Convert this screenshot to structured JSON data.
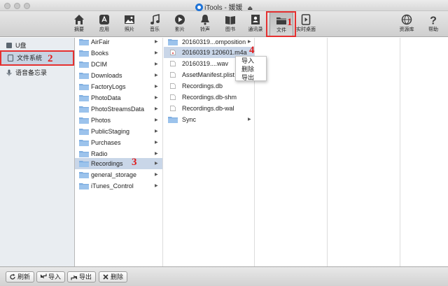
{
  "window": {
    "app_name": "iTools",
    "separator": "-",
    "device_name": "媛媛",
    "eject_glyph": "⏏"
  },
  "toolbar": {
    "items": [
      {
        "label": "摘要",
        "icon": "home-icon"
      },
      {
        "label": "应用",
        "icon": "apps-icon"
      },
      {
        "label": "照片",
        "icon": "photos-icon"
      },
      {
        "label": "音乐",
        "icon": "music-icon"
      },
      {
        "label": "影片",
        "icon": "play-icon"
      },
      {
        "label": "铃声",
        "icon": "bell-icon"
      },
      {
        "label": "图书",
        "icon": "books-icon"
      },
      {
        "label": "通讯录",
        "icon": "contacts-icon"
      },
      {
        "label": "文件",
        "icon": "folder-icon",
        "active": true
      },
      {
        "label": "实时桌面",
        "icon": "live-desktop-icon"
      },
      {
        "label": "资源库",
        "icon": "resource-icon"
      },
      {
        "label": "帮助",
        "icon": "help-icon"
      }
    ]
  },
  "sidebar": {
    "items": [
      {
        "label": "U盘",
        "icon": "usb-drive-icon"
      },
      {
        "label": "文件系统",
        "icon": "file-system-icon",
        "selected": true
      },
      {
        "label": "语音备忘录",
        "icon": "microphone-icon"
      }
    ]
  },
  "column1": {
    "items": [
      "AirFair",
      "Books",
      "DCIM",
      "Downloads",
      "FactoryLogs",
      "PhotoData",
      "PhotoStreamsData",
      "Photos",
      "PublicStaging",
      "Purchases",
      "Radio",
      "Recordings",
      "general_storage",
      "iTunes_Control"
    ],
    "selected": "Recordings"
  },
  "column2": {
    "items": [
      {
        "label": "20160319...omposition",
        "type": "folder"
      },
      {
        "label": "20160319 120601.m4a",
        "type": "file",
        "selected": true
      },
      {
        "label": "20160319....wav",
        "type": "file"
      },
      {
        "label": "AssetManifest.plist",
        "type": "file"
      },
      {
        "label": "Recordings.db",
        "type": "file"
      },
      {
        "label": "Recordings.db-shm",
        "type": "file"
      },
      {
        "label": "Recordings.db-wal",
        "type": "file"
      },
      {
        "label": "Sync",
        "type": "folder"
      }
    ]
  },
  "context_menu": {
    "items": [
      "导入",
      "删除",
      "导出"
    ]
  },
  "bottom": {
    "buttons": [
      {
        "label": "刷新",
        "icon": "refresh-icon"
      },
      {
        "label": "导入",
        "icon": "import-icon"
      },
      {
        "label": "导出",
        "icon": "export-icon"
      },
      {
        "label": "删除",
        "icon": "delete-icon"
      }
    ]
  },
  "annotations": [
    "1",
    "2",
    "3",
    "4"
  ],
  "colors": {
    "annotation_red": "#e01a1a",
    "selection": "#c9d6e8",
    "sidebar_bg": "#e9edf1",
    "folder_blue": "#7faee0"
  }
}
